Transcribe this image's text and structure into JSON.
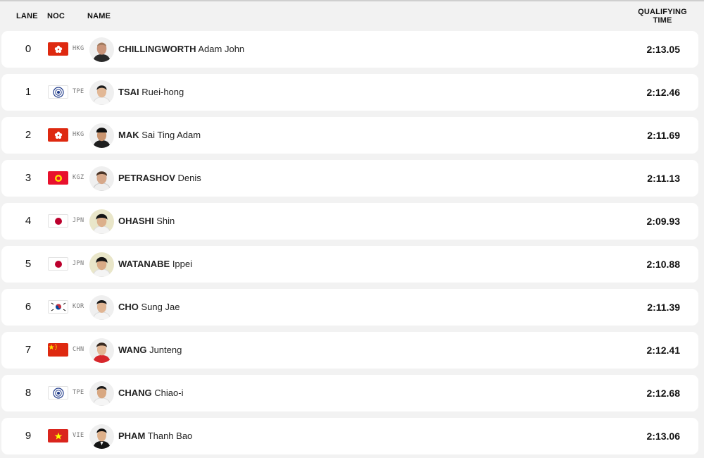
{
  "header": {
    "lane": "LANE",
    "noc": "NOC",
    "name": "NAME",
    "qualifying_line1": "QUALIFYING",
    "qualifying_line2": "TIME"
  },
  "rows": [
    {
      "lane": "0",
      "flag": "hkg-flag-icon",
      "noc": "HKG",
      "surname": "CHILLINGWORTH",
      "given": "Adam John",
      "time": "2:13.05"
    },
    {
      "lane": "1",
      "flag": "tpe-flag-icon",
      "noc": "TPE",
      "surname": "TSAI",
      "given": "Ruei-hong",
      "time": "2:12.46"
    },
    {
      "lane": "2",
      "flag": "hkg-flag-icon",
      "noc": "HKG",
      "surname": "MAK",
      "given": "Sai Ting Adam",
      "time": "2:11.69"
    },
    {
      "lane": "3",
      "flag": "kgz-flag-icon",
      "noc": "KGZ",
      "surname": "PETRASHOV",
      "given": "Denis",
      "time": "2:11.13"
    },
    {
      "lane": "4",
      "flag": "jpn-flag-icon",
      "noc": "JPN",
      "surname": "OHASHI",
      "given": "Shin",
      "time": "2:09.93"
    },
    {
      "lane": "5",
      "flag": "jpn-flag-icon",
      "noc": "JPN",
      "surname": "WATANABE",
      "given": "Ippei",
      "time": "2:10.88"
    },
    {
      "lane": "6",
      "flag": "kor-flag-icon",
      "noc": "KOR",
      "surname": "CHO",
      "given": "Sung Jae",
      "time": "2:11.39"
    },
    {
      "lane": "7",
      "flag": "chn-flag-icon",
      "noc": "CHN",
      "surname": "WANG",
      "given": "Junteng",
      "time": "2:12.41"
    },
    {
      "lane": "8",
      "flag": "tpe-flag-icon",
      "noc": "TPE",
      "surname": "CHANG",
      "given": "Chiao-i",
      "time": "2:12.68"
    },
    {
      "lane": "9",
      "flag": "vie-flag-icon",
      "noc": "VIE",
      "surname": "PHAM",
      "given": "Thanh Bao",
      "time": "2:13.06"
    }
  ],
  "colors": {
    "background": "#f2f2f2",
    "row": "#ffffff",
    "hkg_red": "#de2910",
    "jpn_red": "#bc002d",
    "kgz_red": "#e8112d",
    "vie_red": "#da251d",
    "star_yellow": "#ffde00"
  }
}
